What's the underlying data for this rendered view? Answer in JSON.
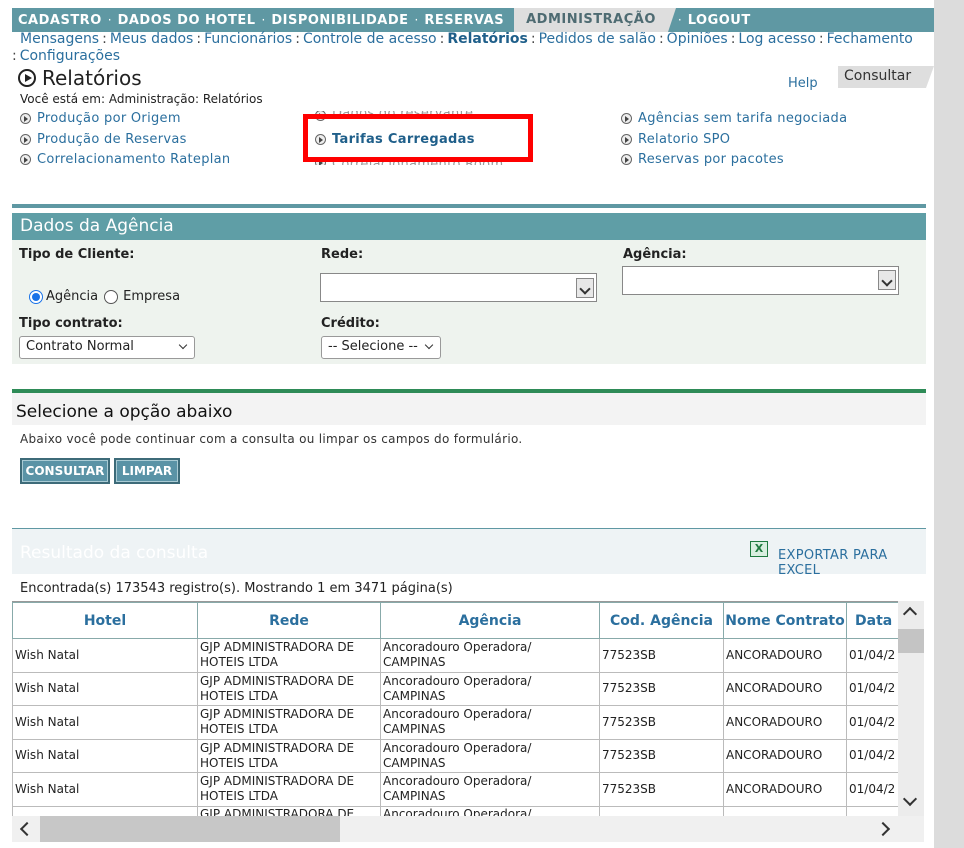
{
  "topnav": {
    "items": [
      "CADASTRO",
      "DADOS DO HOTEL",
      "DISPONIBILIDADE",
      "RESERVAS",
      "ADMINISTRAÇÃO",
      "LOGOUT"
    ],
    "separator": "·"
  },
  "subnav": {
    "items": [
      "Mensagens",
      "Meus dados",
      "Funcionários",
      "Controle de acesso",
      "Relatórios",
      "Pedidos de salão",
      "Opiniões",
      "Log acesso",
      "Fechamento",
      "Configurações"
    ],
    "separator": ":"
  },
  "page": {
    "title": "Relatórios",
    "help": "Help",
    "consultar_tab": "Consultar",
    "breadcrumb": "Você está em: Administração: Relatórios"
  },
  "reports": {
    "col1": [
      "Produção por Origem",
      "Produção de Reservas",
      "Correlacionamento Rateplan"
    ],
    "col2": [
      "Dados do reservante",
      "Tarifas Carregadas",
      "Correlacionamento Room"
    ],
    "col3": [
      "Agências sem tarifa negociada",
      "Relatorio SPO",
      "Reservas por pacotes"
    ]
  },
  "agency_panel": {
    "header": "Dados da Agência",
    "tipo_cliente_label": "Tipo de Cliente:",
    "radio_agencia": "Agência",
    "radio_empresa": "Empresa",
    "rede_label": "Rede:",
    "agencia_label": "Agência:",
    "tipo_contrato_label": "Tipo contrato:",
    "tipo_contrato_value": "Contrato Normal",
    "credito_label": "Crédito:",
    "credito_value": "-- Selecione --"
  },
  "options": {
    "header": "Selecione a opção abaixo",
    "description": "Abaixo você pode continuar com a consulta ou limpar os campos do formulário.",
    "consultar_btn": "CONSULTAR",
    "limpar_btn": "LIMPAR"
  },
  "results": {
    "header": "Resultado da consulta",
    "excel_label": "EXPORTAR PARA EXCEL",
    "count_text": "Encontrada(s) 173543 registro(s). Mostrando 1 em 3471 página(s)",
    "columns": [
      "Hotel",
      "Rede",
      "Agência",
      "Cod. Agência",
      "Nome Contrato",
      "Data I"
    ],
    "rows": [
      [
        "Wish Natal",
        "GJP ADMINISTRADORA DE HOTEIS LTDA",
        "Ancoradouro Operadora/ CAMPINAS",
        "77523SB",
        "ANCORADOURO",
        "01/04/2"
      ],
      [
        "Wish Natal",
        "GJP ADMINISTRADORA DE HOTEIS LTDA",
        "Ancoradouro Operadora/ CAMPINAS",
        "77523SB",
        "ANCORADOURO",
        "01/04/2"
      ],
      [
        "Wish Natal",
        "GJP ADMINISTRADORA DE HOTEIS LTDA",
        "Ancoradouro Operadora/ CAMPINAS",
        "77523SB",
        "ANCORADOURO",
        "01/04/2"
      ],
      [
        "Wish Natal",
        "GJP ADMINISTRADORA DE HOTEIS LTDA",
        "Ancoradouro Operadora/ CAMPINAS",
        "77523SB",
        "ANCORADOURO",
        "01/04/2"
      ],
      [
        "Wish Natal",
        "GJP ADMINISTRADORA DE HOTEIS LTDA",
        "Ancoradouro Operadora/ CAMPINAS",
        "77523SB",
        "ANCORADOURO",
        "01/04/2"
      ],
      [
        "",
        "GJP ADMINISTRADORA DE",
        "Ancoradouro Operadora/",
        "",
        "",
        ""
      ]
    ]
  },
  "colors": {
    "nav_bg": "#5f98a3",
    "link": "#2b6f9e",
    "highlight": "#ff0000",
    "green_sep": "#2e8b57"
  },
  "icons": {
    "title": "circle-play-icon",
    "report_bullet": "circle-play-icon",
    "excel": "excel-icon"
  }
}
